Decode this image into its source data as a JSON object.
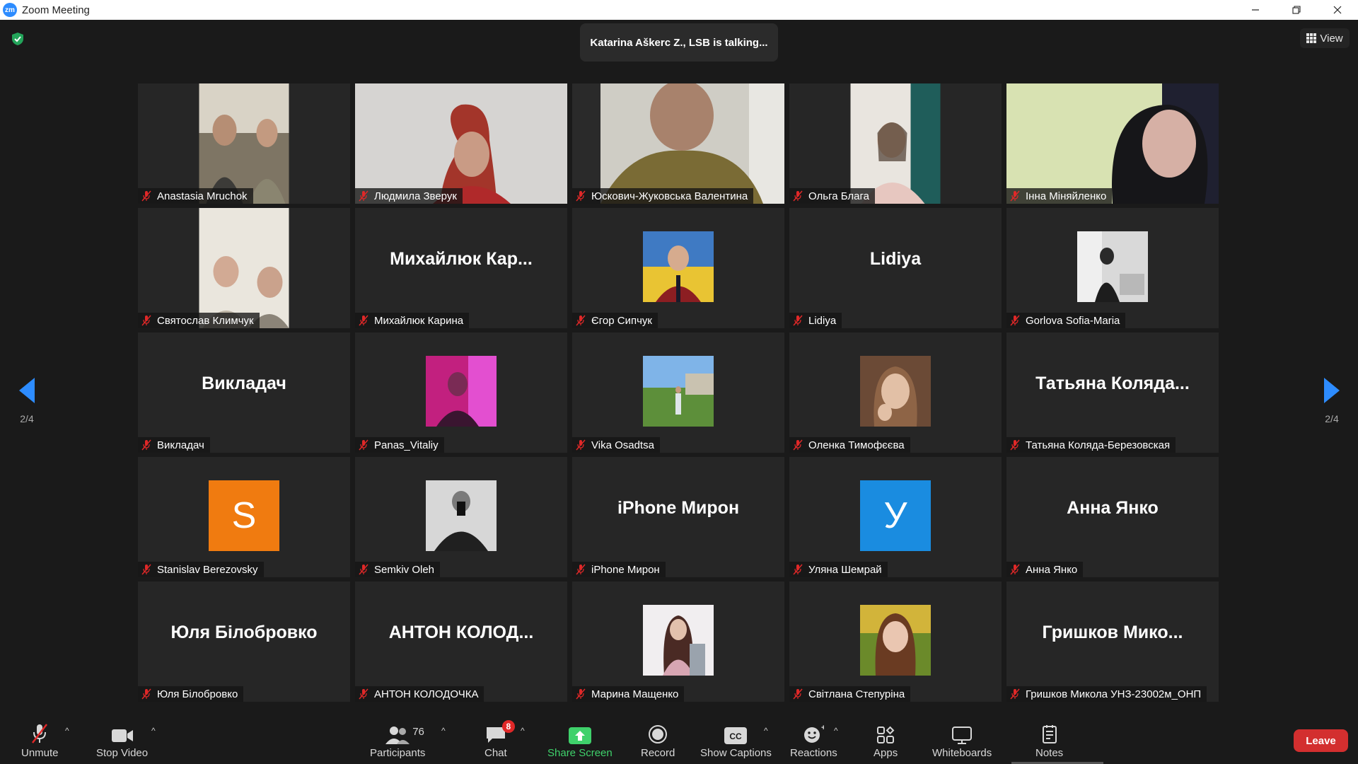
{
  "window": {
    "title": "Zoom Meeting",
    "logo_text": "zm"
  },
  "top": {
    "speaker_banner": "Katarina Aškerc Z., LSB is talking...",
    "view_label": "View"
  },
  "pagination": {
    "current": "2/4"
  },
  "tiles": [
    {
      "label": "Anastasia Mruchok",
      "big": ""
    },
    {
      "label": "Людмила Зверук",
      "big": ""
    },
    {
      "label": "Юскович-Жуковська Валентина",
      "big": ""
    },
    {
      "label": "Ольга Блага",
      "big": ""
    },
    {
      "label": "Інна Міняйленко",
      "big": ""
    },
    {
      "label": "Святослав Климчук",
      "big": ""
    },
    {
      "label": "Михайлюк Карина",
      "big": "Михайлюк  Кар..."
    },
    {
      "label": "Єгор Сипчук",
      "big": ""
    },
    {
      "label": "Lidiya",
      "big": "Lidiya"
    },
    {
      "label": "Gorlova Sofia-Maria",
      "big": ""
    },
    {
      "label": "Викладач",
      "big": "Викладач"
    },
    {
      "label": "Panas_Vitaliy",
      "big": ""
    },
    {
      "label": "Vika Osadtsa",
      "big": ""
    },
    {
      "label": "Оленка Тимофєєва",
      "big": ""
    },
    {
      "label": "Татьяна Коляда-Березовская",
      "big": "Татьяна  Коляда..."
    },
    {
      "label": "Stanislav Berezovsky",
      "big": "",
      "avatar_letter": "S",
      "avatar_color": "#f07b10"
    },
    {
      "label": "Semkiv Oleh",
      "big": ""
    },
    {
      "label": "iPhone Мирон",
      "big": "iPhone Мирон"
    },
    {
      "label": "Уляна Шемрай",
      "big": "",
      "avatar_letter": "У",
      "avatar_color": "#1a8ce0"
    },
    {
      "label": "Анна Янко",
      "big": "Анна Янко"
    },
    {
      "label": "Юля Білобровко",
      "big": "Юля Білобровко"
    },
    {
      "label": "АНТОН КОЛОДОЧКА",
      "big": "АНТОН  КОЛОД..."
    },
    {
      "label": "Марина Мащенко",
      "big": ""
    },
    {
      "label": "Світлана Степуріна",
      "big": ""
    },
    {
      "label": "Гришков Микола УНЗ-23002м_ОНП",
      "big": "Гришков  Мико..."
    }
  ],
  "toolbar": {
    "unmute": "Unmute",
    "stop_video": "Stop Video",
    "participants": "Participants",
    "participants_count": "76",
    "chat": "Chat",
    "chat_badge": "8",
    "share_screen": "Share Screen",
    "record": "Record",
    "show_captions": "Show Captions",
    "reactions": "Reactions",
    "apps": "Apps",
    "whiteboards": "Whiteboards",
    "notes": "Notes",
    "leave": "Leave"
  },
  "colors": {
    "accent": "#2d8cff",
    "share_green": "#3fd16b",
    "leave_red": "#d32f2f",
    "mute_red": "#e02828"
  }
}
